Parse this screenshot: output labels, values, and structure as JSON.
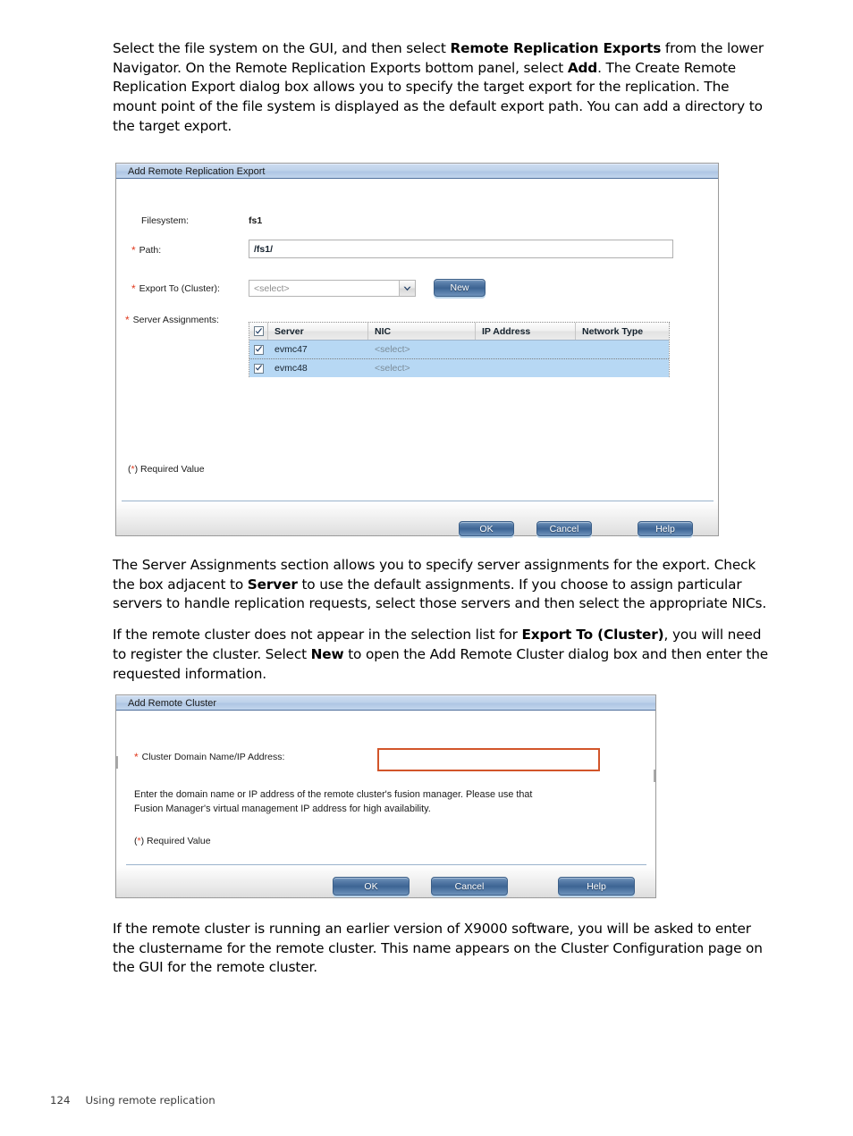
{
  "page": {
    "footer_number": "124",
    "footer_title": "Using remote replication"
  },
  "paragraphs": {
    "p1_a": "Select the file system on the GUI, and then select ",
    "p1_b1": "Remote Replication Exports",
    "p1_c": " from the lower Navigator. On the Remote Replication Exports bottom panel, select ",
    "p1_b2": "Add",
    "p1_d": ". The Create Remote Replication Export dialog box allows you to specify the target export for the replication. The mount point of the file system is displayed as the default export path. You can add a directory to the target export.",
    "p2_a": "The Server Assignments section allows you to specify server assignments for the export. Check the box adjacent to ",
    "p2_b1": "Server",
    "p2_c": " to use the default assignments. If you choose to assign particular servers to handle replication requests, select those servers and then select the appropriate NICs.",
    "p3_a": "If the remote cluster does not appear in the selection list for ",
    "p3_b1": "Export To (Cluster)",
    "p3_c": ", you will need to register the cluster. Select ",
    "p3_b2": "New",
    "p3_d": " to open the Add Remote Cluster dialog box and then enter the requested information.",
    "p4": "If the remote cluster is running an earlier version of X9000 software, you will be asked to enter the clustername for the remote cluster. This name appears on the Cluster Configuration page on the GUI for the remote cluster."
  },
  "dialog_export": {
    "title": "Add Remote Replication Export",
    "filesystem_label": "Filesystem:",
    "filesystem_value": "fs1",
    "path_label": "Path:",
    "path_value": "/fs1/",
    "export_to_label": "Export To (Cluster):",
    "export_to_value": "<select>",
    "new_button": "New",
    "server_assignments_label": "Server Assignments:",
    "required_note": "(*) Required Value",
    "required_note_star": "*",
    "required_note_pre": "(",
    "required_note_post": ") Required Value",
    "table": {
      "columns": [
        "",
        "Server",
        "NIC",
        "IP Address",
        "Network Type"
      ],
      "header_checked": true,
      "rows": [
        {
          "checked": true,
          "server": "evmc47",
          "nic": "<select>",
          "ip": "",
          "network_type": ""
        },
        {
          "checked": true,
          "server": "evmc48",
          "nic": "<select>",
          "ip": "",
          "network_type": ""
        }
      ]
    },
    "buttons": {
      "ok": "OK",
      "cancel": "Cancel",
      "help": "Help"
    }
  },
  "dialog_cluster": {
    "title": "Add Remote Cluster",
    "domain_label": "Cluster Domain Name/IP Address:",
    "domain_value": "",
    "helper_line1": "Enter the domain name or IP address of the remote cluster's fusion manager. Please use that",
    "helper_line2": "Fusion Manager's virtual management IP address for high availability.",
    "required_note_star": "*",
    "required_note_pre": "(",
    "required_note_post": ") Required Value",
    "buttons": {
      "ok": "OK",
      "cancel": "Cancel",
      "help": "Help"
    }
  },
  "colors": {
    "required_star": "#e03a1e",
    "required_field_border": "#d2552a",
    "titlebar_accent": "#4f6f9c",
    "button_blue": "#3d6493",
    "row_selected": "#b7d8f4"
  }
}
